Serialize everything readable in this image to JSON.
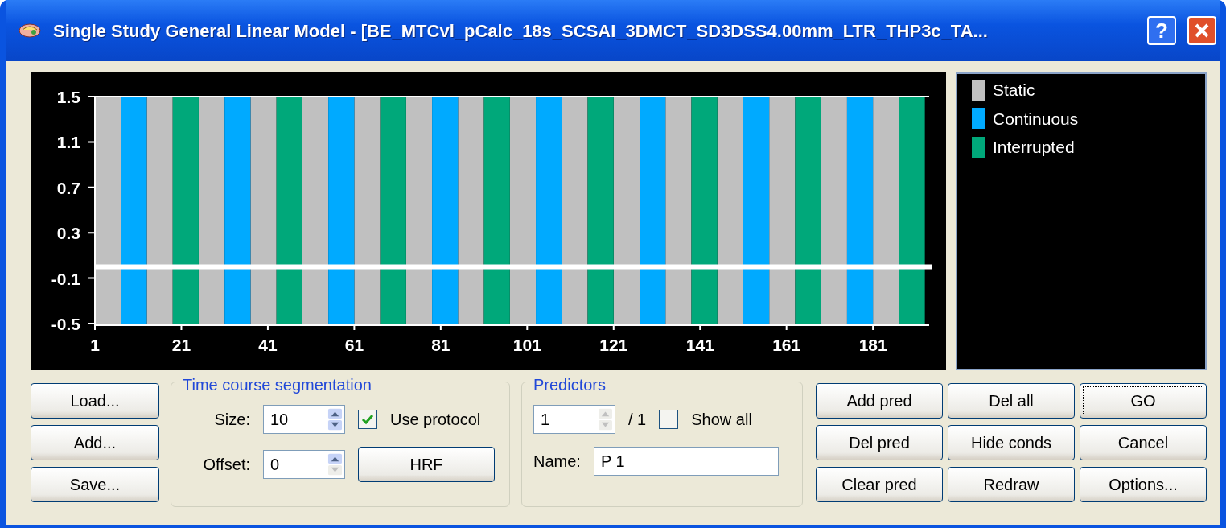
{
  "window": {
    "title": "Single Study General Linear Model - [BE_MTCvl_pCalc_18s_SCSAI_3DMCT_SD3DSS4.00mm_LTR_THP3c_TA...",
    "help": "?"
  },
  "chart": {
    "chart_data": {
      "type": "bar",
      "stacked": true,
      "x": [
        4,
        10,
        16,
        22,
        28,
        34,
        40,
        46,
        52,
        58,
        64,
        70,
        76,
        82,
        88,
        94,
        100,
        106,
        112,
        118,
        124,
        130,
        136,
        142,
        148,
        154,
        160,
        166,
        172,
        178,
        184,
        190
      ],
      "xlim": [
        1,
        194
      ],
      "ylim": [
        -0.5,
        1.5
      ],
      "xticks": [
        1,
        21,
        41,
        61,
        81,
        101,
        121,
        141,
        161,
        181
      ],
      "yticks": [
        1.5,
        1.1,
        0.7,
        0.3,
        -0.1,
        -0.5
      ],
      "series": [
        {
          "name": "Static",
          "color": "#c0c0c0",
          "values": [
            1.5,
            null,
            1.5,
            null,
            1.5,
            null,
            1.5,
            null,
            1.5,
            null,
            1.5,
            null,
            1.5,
            null,
            1.5,
            null,
            1.5,
            null,
            1.5,
            null,
            1.5,
            null,
            1.5,
            null,
            1.5,
            null,
            1.5,
            null,
            1.5,
            null,
            1.5,
            null
          ]
        },
        {
          "color": "#c0c0c0",
          "values": [
            -0.5,
            null,
            -0.5,
            null,
            -0.5,
            null,
            -0.5,
            null,
            -0.5,
            null,
            -0.5,
            null,
            -0.5,
            null,
            -0.5,
            null,
            -0.5,
            null,
            -0.5,
            null,
            -0.5,
            null,
            -0.5,
            null,
            -0.5,
            null,
            -0.5,
            null,
            -0.5,
            null,
            -0.5,
            null
          ]
        },
        {
          "name": "Continuous",
          "color": "#00aaff",
          "values": [
            null,
            1.5,
            null,
            null,
            null,
            1.5,
            null,
            null,
            null,
            1.5,
            null,
            null,
            null,
            1.5,
            null,
            null,
            null,
            1.5,
            null,
            null,
            null,
            1.5,
            null,
            null,
            null,
            1.5,
            null,
            null,
            null,
            1.5,
            null,
            null
          ]
        },
        {
          "color": "#00aaff",
          "values": [
            null,
            -0.5,
            null,
            null,
            null,
            -0.5,
            null,
            null,
            null,
            -0.5,
            null,
            null,
            null,
            -0.5,
            null,
            null,
            null,
            -0.5,
            null,
            null,
            null,
            -0.5,
            null,
            null,
            null,
            -0.5,
            null,
            null,
            null,
            -0.5,
            null,
            null
          ]
        },
        {
          "name": "Interrupted",
          "color": "#00a87a",
          "values": [
            null,
            null,
            null,
            1.5,
            null,
            null,
            null,
            1.5,
            null,
            null,
            null,
            1.5,
            null,
            null,
            null,
            1.5,
            null,
            null,
            null,
            1.5,
            null,
            null,
            null,
            1.5,
            null,
            null,
            null,
            1.5,
            null,
            null,
            null,
            1.5
          ]
        },
        {
          "color": "#00a87a",
          "values": [
            null,
            null,
            null,
            -0.5,
            null,
            null,
            null,
            -0.5,
            null,
            null,
            null,
            -0.5,
            null,
            null,
            null,
            -0.5,
            null,
            null,
            null,
            -0.5,
            null,
            null,
            null,
            -0.5,
            null,
            null,
            null,
            -0.5,
            null,
            null,
            null,
            -0.5
          ]
        }
      ]
    }
  },
  "file_buttons": [
    "Load...",
    "Add...",
    "Save..."
  ],
  "segmentation": {
    "title": "Time course segmentation",
    "size_label": "Size:",
    "size_value": "10",
    "size_spin_disabled": false,
    "offset_label": "Offset:",
    "offset_value": "0",
    "offset_down_disabled": true,
    "use_protocol": {
      "label": "Use protocol",
      "checked": true
    },
    "hrf_button": "HRF"
  },
  "predictors": {
    "title": "Predictors",
    "index_value": "1",
    "index_spin_disabled": true,
    "count": "/ 1",
    "show_all": {
      "label": "Show all",
      "checked": false
    },
    "name_label": "Name:",
    "name_value": "P 1"
  },
  "action_buttons": [
    {
      "label": "Add pred",
      "focused": false
    },
    {
      "label": "Del all",
      "focused": false
    },
    {
      "label": "GO",
      "focused": true
    },
    {
      "label": "Del pred",
      "focused": false
    },
    {
      "label": "Hide conds",
      "focused": false
    },
    {
      "label": "Cancel",
      "focused": false
    },
    {
      "label": "Clear pred",
      "focused": false
    },
    {
      "label": "Redraw",
      "focused": false
    },
    {
      "label": "Options...",
      "focused": false
    }
  ]
}
